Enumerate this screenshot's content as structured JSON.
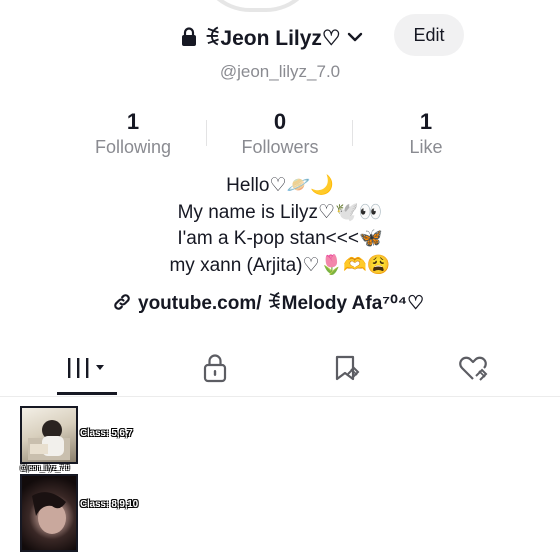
{
  "profile": {
    "display_name": "ꉂJeon Lilyz♡",
    "handle": "@jeon_lilyz_7.0",
    "edit_label": "Edit"
  },
  "stats": [
    {
      "value": "1",
      "label": "Following"
    },
    {
      "value": "0",
      "label": "Followers"
    },
    {
      "value": "1",
      "label": "Like"
    }
  ],
  "bio": {
    "lines": [
      "Hello♡🪐🌙",
      "My name is Lilyz♡🕊️👀",
      "I'am a K-pop stan<<<🦋",
      "my xann (Arjita)♡🌷🫶😩"
    ]
  },
  "link": {
    "text": "youtube.com/ ꉂMelody Afa⁷⁰⁴♡"
  },
  "tabs": [
    {
      "icon": "grid-icon",
      "active": true
    },
    {
      "icon": "lock-icon",
      "active": false
    },
    {
      "icon": "saved-icon",
      "active": false
    },
    {
      "icon": "liked-icon",
      "active": false
    }
  ],
  "posts": [
    {
      "class_label": "Class: 5,6,7"
    },
    {
      "handle_watermark": "@jeon_lilyz_7.0",
      "class_label": "Class: 8,9,10"
    }
  ]
}
